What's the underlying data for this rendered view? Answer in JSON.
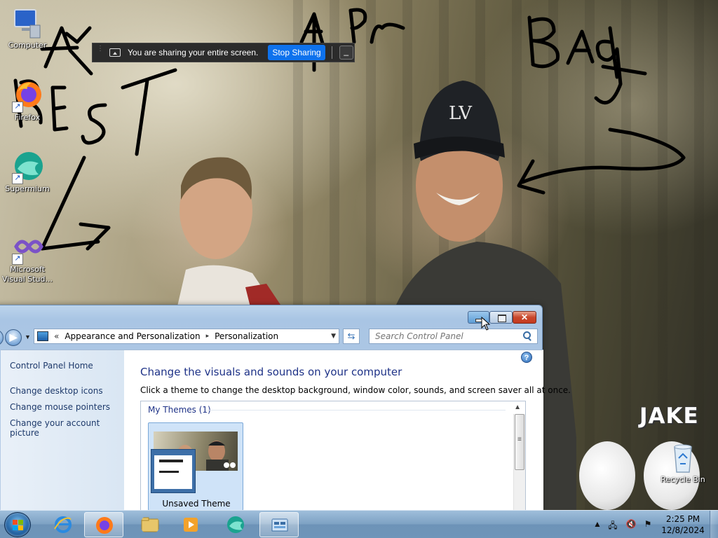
{
  "desktop": {
    "wallpaper_text": "JAKE",
    "icons": [
      {
        "label": "Computer"
      },
      {
        "label": "Firefox"
      },
      {
        "label": "Supermium"
      },
      {
        "label": "Microsoft Visual Stud..."
      },
      {
        "label": "Recycle Bin"
      }
    ],
    "annotations": [
      "A",
      "T",
      "Best",
      "A Pr",
      "BAg"
    ]
  },
  "share_bar": {
    "message": "You are sharing your entire screen.",
    "stop_label": "Stop Sharing",
    "minimize_label": "_"
  },
  "window": {
    "address": {
      "chevron": "«",
      "crumbs": [
        "Appearance and Personalization",
        "Personalization"
      ],
      "separator": "▸"
    },
    "search": {
      "placeholder": "Search Control Panel"
    },
    "sidebar": {
      "home": "Control Panel Home",
      "links": [
        "Change desktop icons",
        "Change mouse pointers",
        "Change your account picture"
      ]
    },
    "main": {
      "title": "Change the visuals and sounds on your computer",
      "description": "Click a theme to change the desktop background, window color, sounds, and screen saver all at once.",
      "group_title": "My Themes (1)",
      "themes": [
        {
          "name": "Unsaved Theme"
        }
      ]
    },
    "help_label": "?"
  },
  "taskbar": {
    "clock_time": "2:25 PM",
    "clock_date": "12/8/2024"
  },
  "colors": {
    "link": "#1e3a6b",
    "heading": "#1e3287",
    "share_button": "#0e72ed",
    "taskbar": "#7ea2c4"
  }
}
